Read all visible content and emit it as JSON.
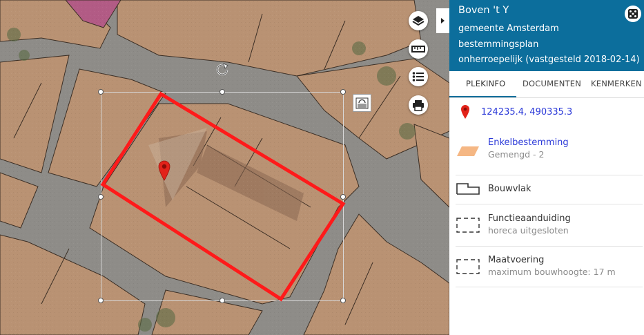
{
  "map": {
    "layers_icon": "layers-icon",
    "measure_icon": "ruler-icon",
    "legend_icon": "list-icon",
    "print_icon": "printer-icon",
    "rotate_icon": "rotate-icon",
    "marker_icon": "map-marker-icon",
    "label_icon": "label-stamp-icon",
    "highlight_color": "#ff0000"
  },
  "panel": {
    "title": "Boven 't Y",
    "municipality": "gemeente Amsterdam",
    "plan_type": "bestemmingsplan",
    "status": "onherroepelijk (vastgesteld 2018-02-14)",
    "header_color": "#0c6e9c",
    "tabs": [
      {
        "label": "PLEKINFO",
        "active": true
      },
      {
        "label": "DOCUMENTEN",
        "active": false
      },
      {
        "label": "KENMERKEN",
        "active": false
      }
    ],
    "coordinates": "124235.4, 490335.3",
    "items": [
      {
        "icon": "zoning-swatch-icon",
        "title": "Enkelbestemming",
        "subtitle": "Gemengd - 2"
      },
      {
        "icon": "building-plane-icon",
        "title": "Bouwvlak",
        "subtitle": ""
      },
      {
        "icon": "dashed-box-icon",
        "title": "Functieaanduiding",
        "subtitle": "horeca uitgesloten"
      },
      {
        "icon": "dashed-box-icon",
        "title": "Maatvoering",
        "subtitle": "maximum bouwhoogte: 17 m"
      }
    ]
  }
}
